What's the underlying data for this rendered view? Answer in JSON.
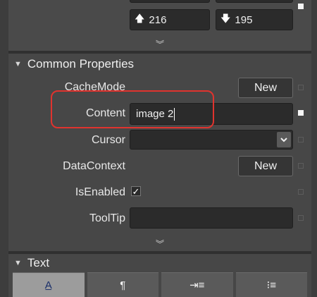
{
  "top": {
    "top_value": "216",
    "bottom_value": "195",
    "top_arrow": "🡅",
    "bottom_arrow": "🡇",
    "top_arrow_icon": "arrow-up-icon",
    "bottom_arrow_icon": "arrow-down-icon"
  },
  "expand_glyph": "︾",
  "common": {
    "title": "Common Properties",
    "rows": {
      "cache_mode": {
        "label": "CacheMode",
        "button": "New"
      },
      "content": {
        "label": "Content",
        "value": "image 2"
      },
      "cursor": {
        "label": "Cursor",
        "value": ""
      },
      "data_context": {
        "label": "DataContext",
        "button": "New"
      },
      "is_enabled": {
        "label": "IsEnabled",
        "checked": true,
        "check_glyph": "✓"
      },
      "tooltip": {
        "label": "ToolTip",
        "value": ""
      }
    }
  },
  "text_section": {
    "title": "Text",
    "tabs": [
      {
        "glyph": "A̲",
        "icon": "font-icon"
      },
      {
        "glyph": "¶",
        "icon": "paragraph-icon"
      },
      {
        "glyph": "⇥≡",
        "icon": "indent-icon"
      },
      {
        "glyph": "⁝≡",
        "icon": "list-icon"
      }
    ]
  },
  "colors": {
    "panel_bg": "#474747",
    "field_bg": "#2b2b2b",
    "highlight": "#e0332e",
    "active_tab": "#9c9c9c"
  }
}
